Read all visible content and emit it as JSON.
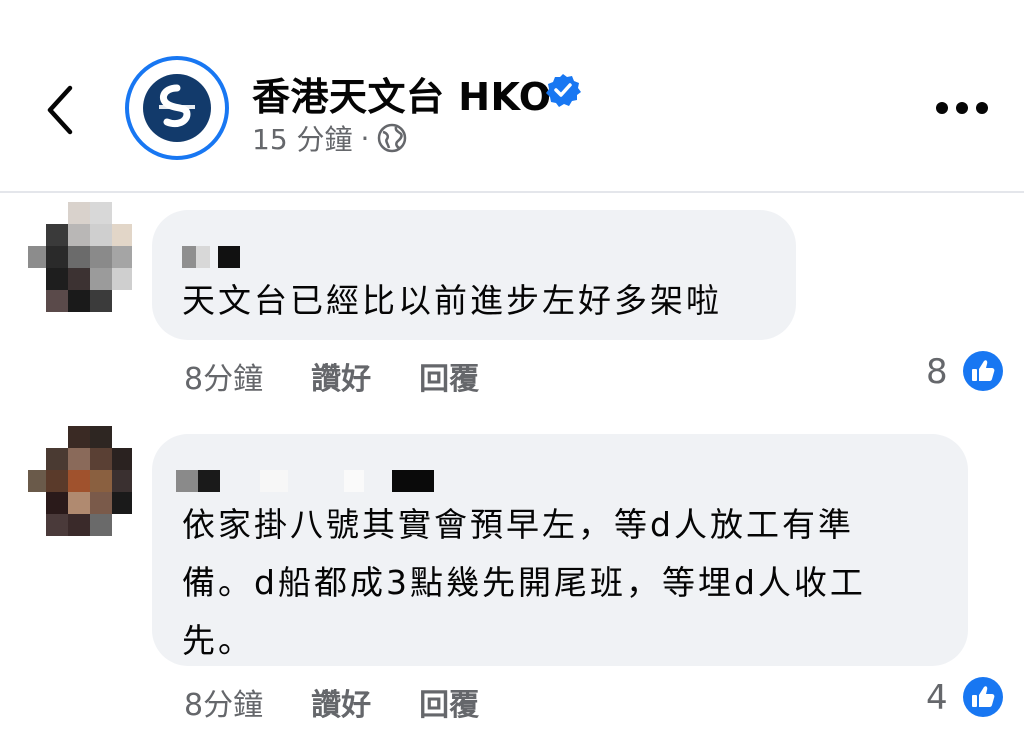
{
  "header": {
    "page_name": "香港天文台 HKO",
    "time": "15 分鐘",
    "separator": "·",
    "icons": {
      "back": "chevron-left-icon",
      "verified": "verified-badge-icon",
      "audience": "globe-icon",
      "more": "more-horizontal-icon"
    },
    "accent_color": "#1877f2"
  },
  "comments": [
    {
      "text_lines": [
        "天文台已經比以前進步左好多架啦"
      ],
      "time": "8分鐘",
      "like_label": "讚好",
      "reply_label": "回覆",
      "like_count": "8"
    },
    {
      "text_lines": [
        "依家掛八號其實會預早左，等d人放工有準",
        "備。d船都成3點幾先開尾班，等埋d人收工",
        "先。"
      ],
      "time": "8分鐘",
      "like_label": "讚好",
      "reply_label": "回覆",
      "like_count": "4"
    }
  ]
}
